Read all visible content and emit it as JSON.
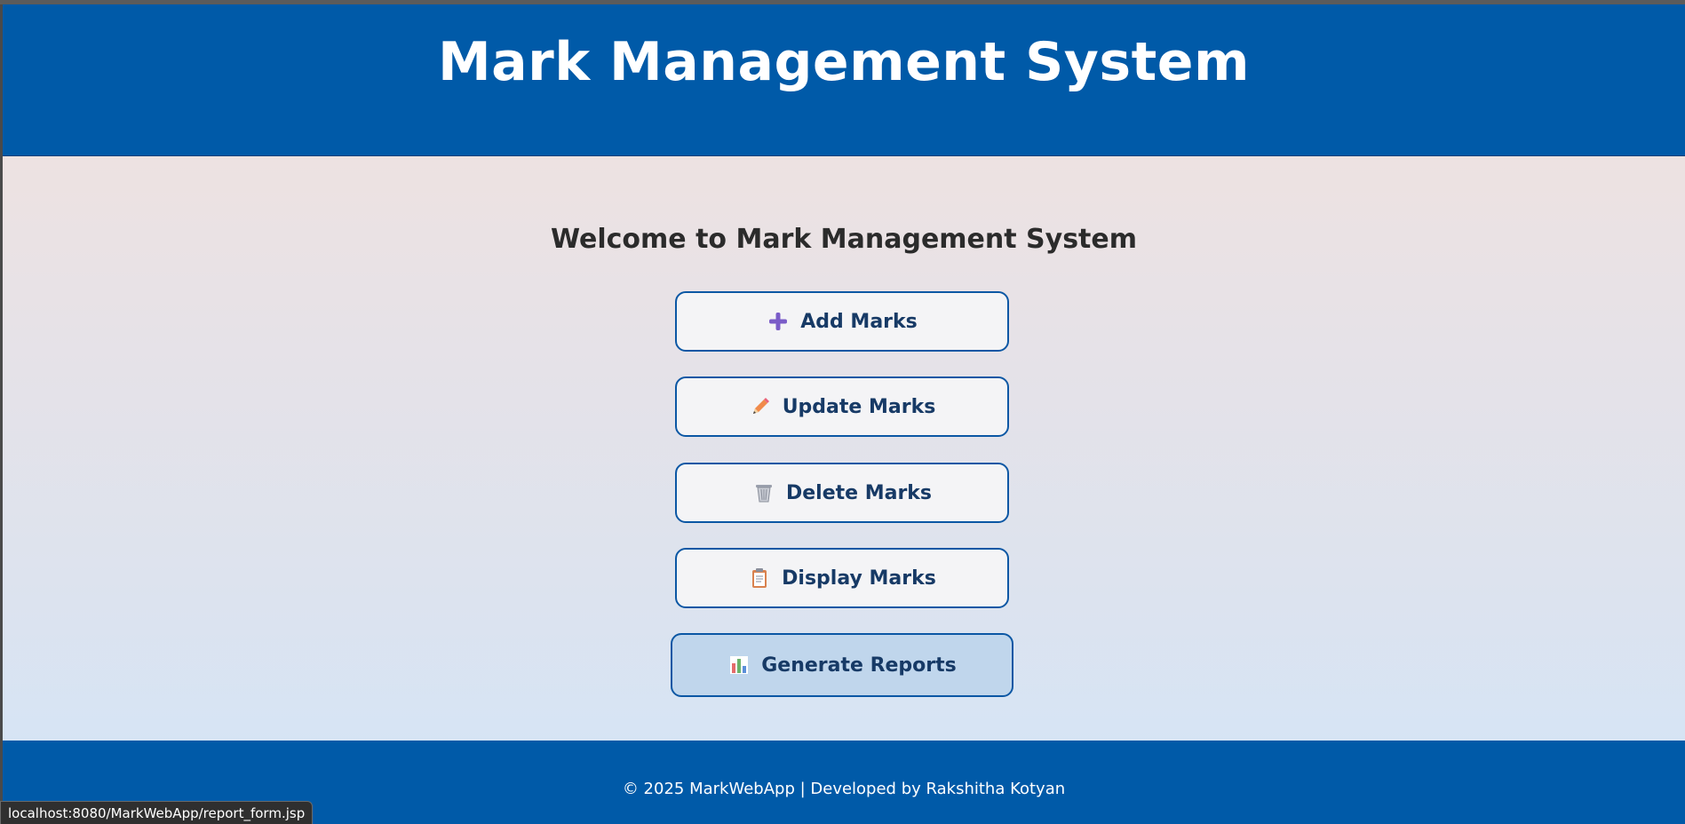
{
  "header": {
    "title": "Mark Management System"
  },
  "main": {
    "welcome": "Welcome to Mark Management System",
    "buttons": [
      {
        "label": "Add Marks",
        "icon": "plus-icon"
      },
      {
        "label": "Update Marks",
        "icon": "pencil-icon"
      },
      {
        "label": "Delete Marks",
        "icon": "wastebasket-icon"
      },
      {
        "label": "Display Marks",
        "icon": "clipboard-icon"
      },
      {
        "label": "Generate Reports",
        "icon": "bar-chart-icon"
      }
    ]
  },
  "footer": {
    "text": "© 2025 MarkWebApp | Developed by Rakshitha Kotyan"
  },
  "status_bar": {
    "url": "localhost:8080/MarkWebApp/report_form.jsp"
  },
  "colors": {
    "primary": "#005aa8",
    "button_border": "#0b57a4",
    "button_text": "#173a66",
    "hover_button_bg": "#c0d6ec"
  }
}
